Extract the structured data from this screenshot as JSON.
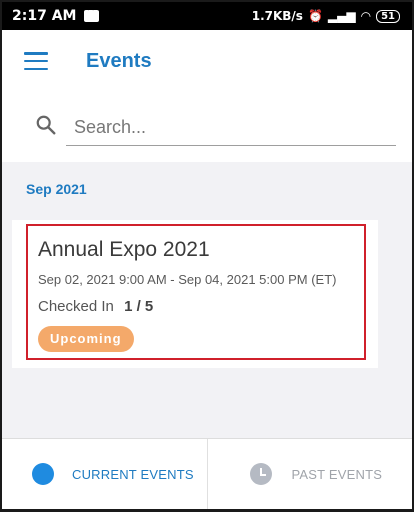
{
  "status_bar": {
    "time": "2:17 AM",
    "speed": "1.7KB/s",
    "battery": "51"
  },
  "header": {
    "title": "Events",
    "menu_icon": "hamburger-menu-icon"
  },
  "search": {
    "placeholder": "Search...",
    "icon": "search-icon"
  },
  "month_label": "Sep 2021",
  "events": [
    {
      "name": "Annual Expo 2021",
      "dates": "Sep 02, 2021 9:00 AM - Sep 04, 2021 5:00 PM (ET)",
      "checked_in_label": "Checked In",
      "checked_in_count": "1 / 5",
      "status": "Upcoming"
    }
  ],
  "bottom_nav": {
    "current": {
      "label": "CURRENT EVENTS",
      "active": true
    },
    "past": {
      "label": "PAST EVENTS",
      "active": false
    }
  },
  "colors": {
    "accent": "#1f7bc1",
    "badge": "#f4a96a",
    "highlight": "#d0202b"
  }
}
